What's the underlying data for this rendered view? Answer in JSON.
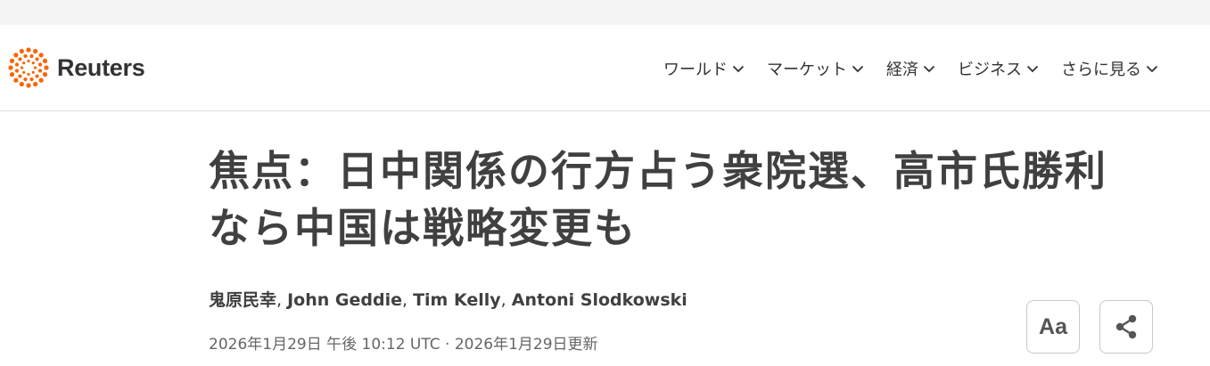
{
  "brand": {
    "name": "Reuters",
    "accent": "#fa6400"
  },
  "nav": {
    "items": [
      {
        "label": "ワールド",
        "icon": "chevron-down-icon"
      },
      {
        "label": "マーケット",
        "icon": "chevron-down-icon"
      },
      {
        "label": "経済",
        "icon": "chevron-down-icon"
      },
      {
        "label": "ビジネス",
        "icon": "chevron-down-icon"
      },
      {
        "label": "さらに見る",
        "icon": "chevron-down-icon"
      }
    ]
  },
  "article": {
    "headline": "焦点：日中関係の行方占う衆院選、高市氏勝利なら中国は戦略変更も",
    "authors": [
      "鬼原民幸",
      "John Geddie",
      "Tim Kelly",
      "Antoni Slodkowski"
    ],
    "dateline": "2026年1月29日 午後 10:12 UTC · 2026年1月29日更新"
  },
  "tools": {
    "font_size_label": "Aa",
    "share_icon": "share-icon"
  }
}
